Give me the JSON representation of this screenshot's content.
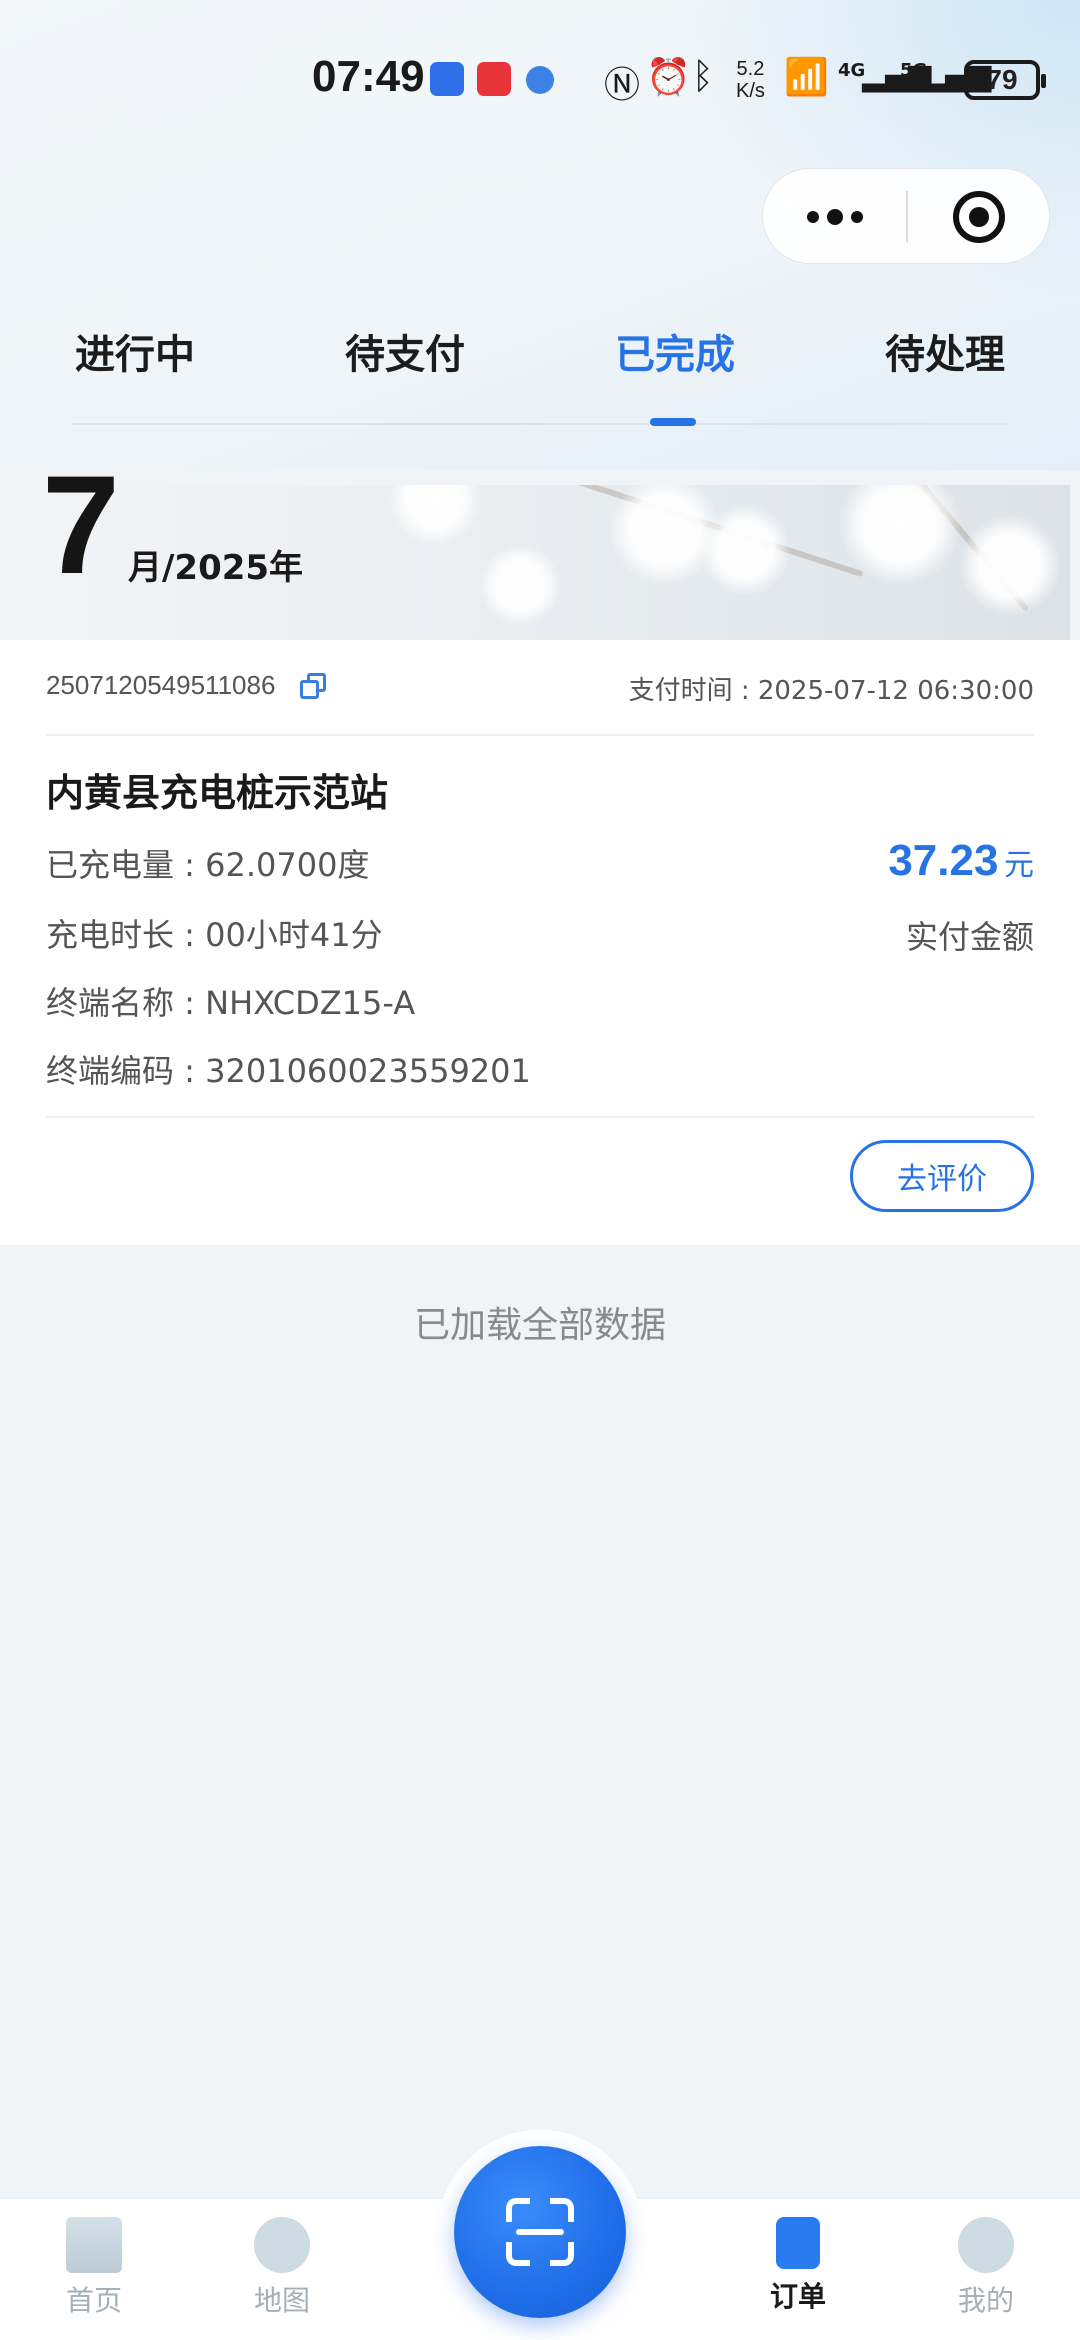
{
  "status_bar": {
    "time": "07:49",
    "speed_value": "5.2",
    "speed_unit": "K/s",
    "net1": "4G",
    "net2": "5G",
    "battery": "79",
    "icons": [
      "nfc-icon",
      "alarm-icon",
      "bluetooth-icon",
      "wifi-icon",
      "signal-icon"
    ]
  },
  "tabs": [
    {
      "label": "进行中"
    },
    {
      "label": "待支付"
    },
    {
      "label": "已完成"
    },
    {
      "label": "待处理"
    }
  ],
  "active_tab": "已完成",
  "month_header": {
    "month": "7",
    "year_text": "月/2025年"
  },
  "order": {
    "order_no": "2507120549511086",
    "pay_time": "支付时间 : 2025-07-12 06:30:00",
    "station": "内黄县充电桩示范站",
    "energy": "已充电量 : 62.0700度",
    "duration": "充电时长 : 00小时41分",
    "terminal_name": "终端名称 : NHXCDZ15-A",
    "terminal_code": "终端编码 : 3201060023559201",
    "amount": "37.23",
    "amount_unit": "元",
    "amount_label": "实付金额",
    "review_button": "去评价"
  },
  "list_footer": "已加载全部数据",
  "bottom_nav": {
    "home": "首页",
    "map": "地图",
    "orders": "订单",
    "mine": "我的"
  },
  "colors": {
    "accent": "#2773e6",
    "background": "#f0f4f6"
  }
}
